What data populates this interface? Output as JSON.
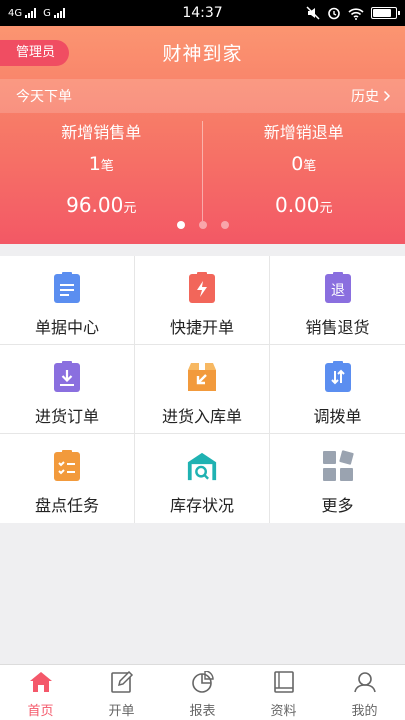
{
  "status_bar": {
    "network1": "4G",
    "network2": "G",
    "time": "14:37"
  },
  "header": {
    "role": "管理员",
    "title": "财神到家"
  },
  "summary": {
    "label": "今天下单",
    "history": "历史",
    "sales": {
      "title": "新增销售单",
      "count": "1",
      "count_unit": "笔",
      "amount": "96.00",
      "amount_unit": "元"
    },
    "returns": {
      "title": "新增销退单",
      "count": "0",
      "count_unit": "笔",
      "amount": "0.00",
      "amount_unit": "元"
    },
    "page_count": 3,
    "active_page": 1
  },
  "menu": [
    {
      "label": "单据中心",
      "icon": "document-center-icon",
      "color": "#5b8ef0"
    },
    {
      "label": "快捷开单",
      "icon": "quick-order-icon",
      "color": "#f2665a"
    },
    {
      "label": "销售退货",
      "icon": "sales-return-icon",
      "color": "#8a6fdf",
      "icon_text": "退"
    },
    {
      "label": "进货订单",
      "icon": "purchase-order-icon",
      "color": "#8a6fdf"
    },
    {
      "label": "进货入库单",
      "icon": "inbound-box-icon",
      "color": "#f29a3c"
    },
    {
      "label": "调拨单",
      "icon": "transfer-icon",
      "color": "#5b8ef0"
    },
    {
      "label": "盘点任务",
      "icon": "stocktake-icon",
      "color": "#f29a3c"
    },
    {
      "label": "库存状况",
      "icon": "inventory-icon",
      "color": "#1fb2b2"
    },
    {
      "label": "更多",
      "icon": "more-icon",
      "color": "#9aa3b0"
    }
  ],
  "tabs": [
    {
      "label": "首页",
      "icon": "home-icon"
    },
    {
      "label": "开单",
      "icon": "edit-icon"
    },
    {
      "label": "报表",
      "icon": "pie-chart-icon"
    },
    {
      "label": "资料",
      "icon": "book-icon"
    },
    {
      "label": "我的",
      "icon": "user-icon"
    }
  ],
  "active_tab": 0,
  "colors": {
    "accent": "#f4586a",
    "hero_top": "#fb9571",
    "hero_bottom": "#f35865",
    "battery_level": 0.85
  }
}
